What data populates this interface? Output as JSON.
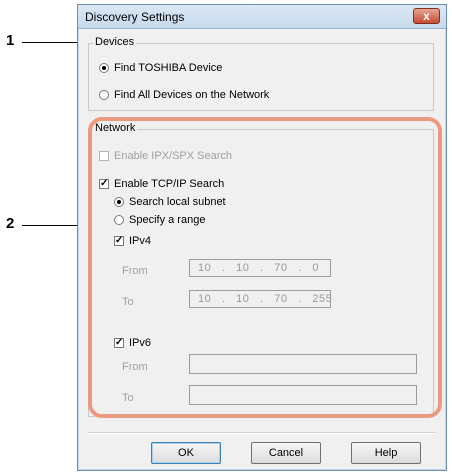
{
  "callouts": {
    "one": "1",
    "two": "2"
  },
  "window": {
    "title": "Discovery Settings",
    "close_symbol": "x"
  },
  "devices": {
    "legend": "Devices",
    "find_toshiba": "Find TOSHIBA Device",
    "find_all": "Find All Devices on the Network",
    "selected": "find_toshiba"
  },
  "network": {
    "legend": "Network",
    "ipx_label": "Enable IPX/SPX Search",
    "tcp_label": "Enable TCP/IP Search",
    "search_local": "Search local subnet",
    "specify_range": "Specify a range",
    "ipv4_label": "IPv4",
    "ipv4_from_label": "From",
    "ipv4_to_label": "To",
    "ipv4_from_value": "10   .   10   .   70   .   0",
    "ipv4_to_value": "10   .   10   .   70   .   255",
    "ipv6_label": "IPv6",
    "ipv6_from_label": "From",
    "ipv6_to_label": "To",
    "ipv6_from_value": "",
    "ipv6_to_value": ""
  },
  "buttons": {
    "ok": "OK",
    "cancel": "Cancel",
    "help": "Help"
  },
  "colors": {
    "highlight": "#ec9a7f",
    "close_button": "#c84b32"
  }
}
